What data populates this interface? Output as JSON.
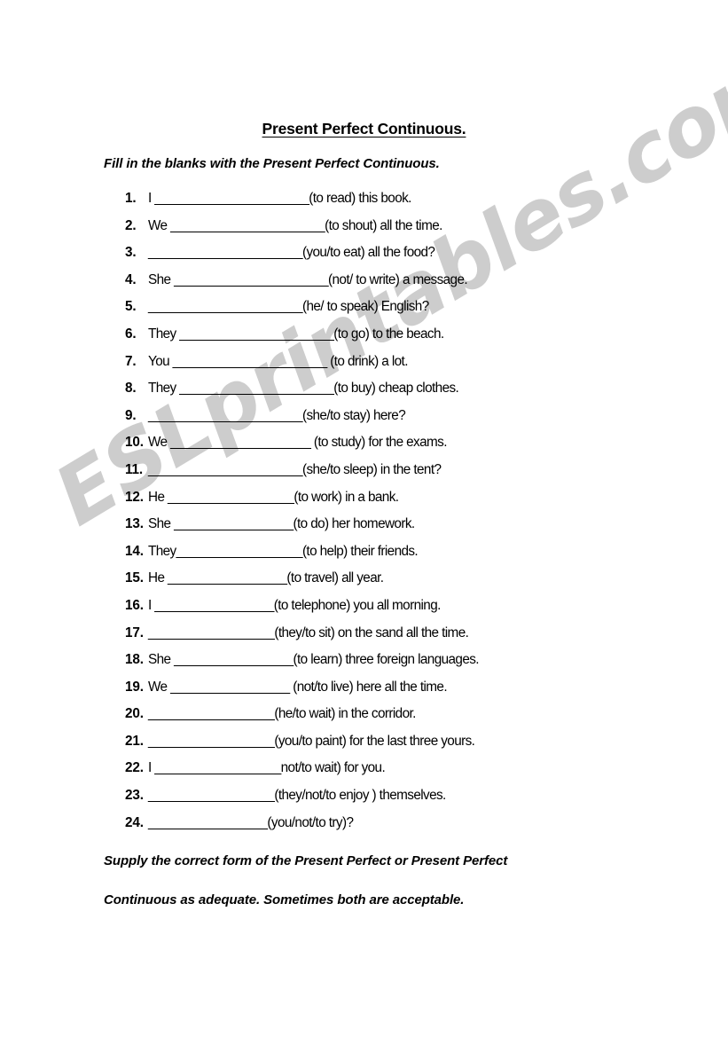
{
  "document": {
    "title": "Present Perfect Continuous.",
    "instruction_top": "Fill in the blanks with the Present Perfect Continuous.",
    "instruction_bottom_line1": "Supply the correct form of the Present Perfect or  Present Perfect",
    "instruction_bottom_line2": "Continuous as adequate.  Sometimes both are acceptable."
  },
  "watermark": {
    "text": "ESLprintables.com",
    "color": "#cdcdcd"
  },
  "exercises": [
    {
      "num": "1.",
      "text": "I ______________________(to read) this book."
    },
    {
      "num": "2.",
      "text": "We ______________________(to shout) all the time."
    },
    {
      "num": "3.",
      "text": "______________________(you/to eat) all the food?"
    },
    {
      "num": "4.",
      "text": "She ______________________(not/ to write) a message."
    },
    {
      "num": "5.",
      "text": "______________________(he/ to speak) English?"
    },
    {
      "num": "6.",
      "text": "They ______________________(to go) to the beach."
    },
    {
      "num": "7.",
      "text": "You ______________________ (to drink) a lot."
    },
    {
      "num": "8.",
      "text": "They ______________________(to buy) cheap clothes."
    },
    {
      "num": "9.",
      "text": "______________________(she/to stay) here?"
    },
    {
      "num": "10.",
      "text": "We ____________________ (to study) for the exams."
    },
    {
      "num": "11.",
      "text": "______________________(she/to sleep) in the tent?"
    },
    {
      "num": "12.",
      "text": "He __________________(to work) in a bank."
    },
    {
      "num": "13.",
      "text": "She _________________(to do) her homework."
    },
    {
      "num": "14.",
      "text": "They__________________(to help) their friends."
    },
    {
      "num": "15.",
      "text": "He _________________(to travel) all year."
    },
    {
      "num": "16.",
      "text": "I _________________(to telephone) you all morning."
    },
    {
      "num": "17.",
      "text": "__________________(they/to sit) on the sand all the time."
    },
    {
      "num": "18.",
      "text": "She _________________(to learn) three foreign languages."
    },
    {
      "num": "19.",
      "text": "We _________________ (not/to live) here all the time."
    },
    {
      "num": "20.",
      "text": "__________________(he/to wait) in the corridor."
    },
    {
      "num": "21.",
      "text": "__________________(you/to paint) for the last three yours."
    },
    {
      "num": "22.",
      "text": "I __________________not/to wait) for you."
    },
    {
      "num": "23.",
      "text": "__________________(they/not/to enjoy ) themselves."
    },
    {
      "num": "24.",
      "text": "_________________(you/not/to try)?"
    }
  ]
}
